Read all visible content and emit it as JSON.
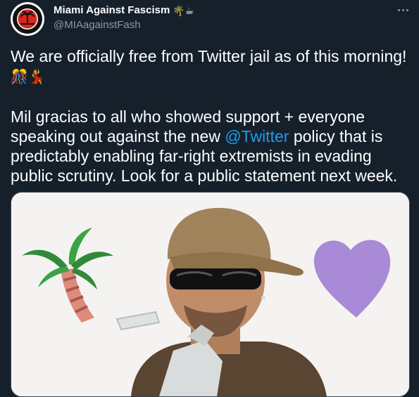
{
  "author": {
    "display_name": "Miami Against Fascism",
    "name_emojis": "🌴☕",
    "handle": "@MIAagainstFash"
  },
  "tweet": {
    "line1_text": "We are officially free from Twitter jail as of this morning!",
    "line1_emojis": "🎊💃",
    "para2_before": "Mil gracias to all who showed support + everyone speaking out against the new",
    "mention": "@Twitter",
    "para2_after": "policy that is predictably enabling far-right extremists in evading public scrutiny. Look for a public statement next week."
  },
  "icons": {
    "more": "more-horizontal-icon",
    "avatar": "antifa-logo-avatar"
  },
  "colors": {
    "background": "#15202b",
    "secondary_text": "#8b98a5",
    "link": "#1d9bf0",
    "media_border": "#38444d"
  }
}
